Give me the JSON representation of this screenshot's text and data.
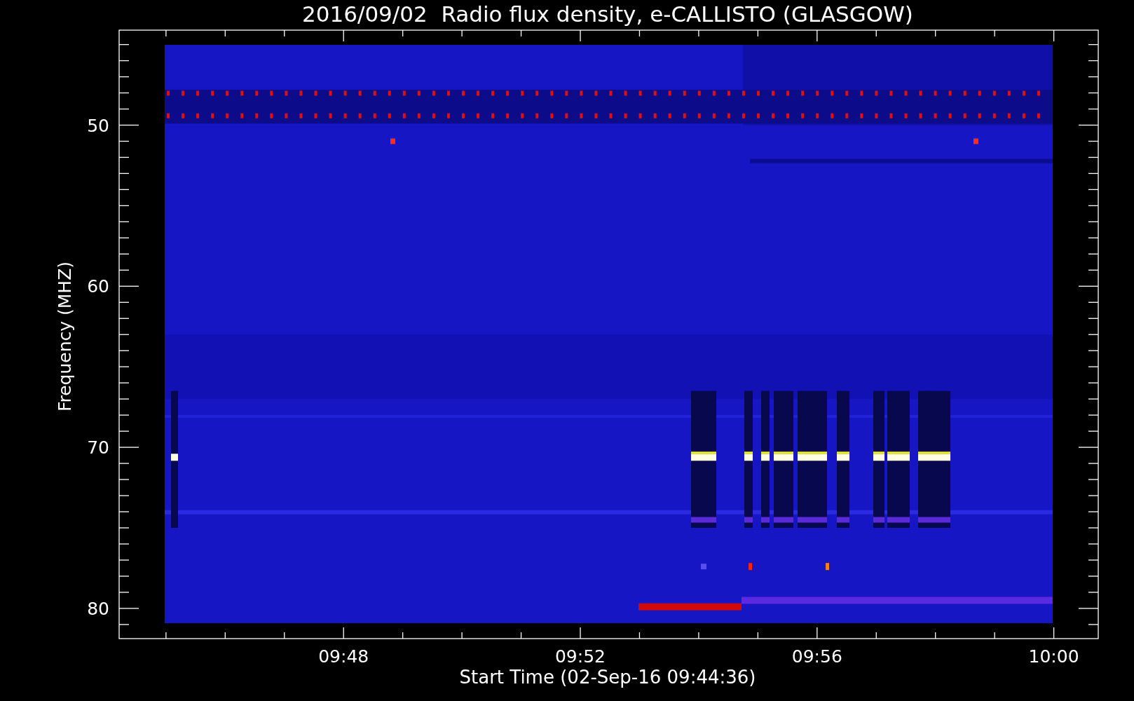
{
  "title": "2016/09/02  Radio flux density, e-CALLISTO (GLASGOW)",
  "y_axis": {
    "label": "Frequency (MHZ)",
    "ticks": [
      "50",
      "60",
      "70",
      "80"
    ]
  },
  "x_axis": {
    "label": "Start Time (02-Sep-16 09:44:36)",
    "ticks": [
      "09:48",
      "09:52",
      "09:56",
      "10:00"
    ]
  }
}
